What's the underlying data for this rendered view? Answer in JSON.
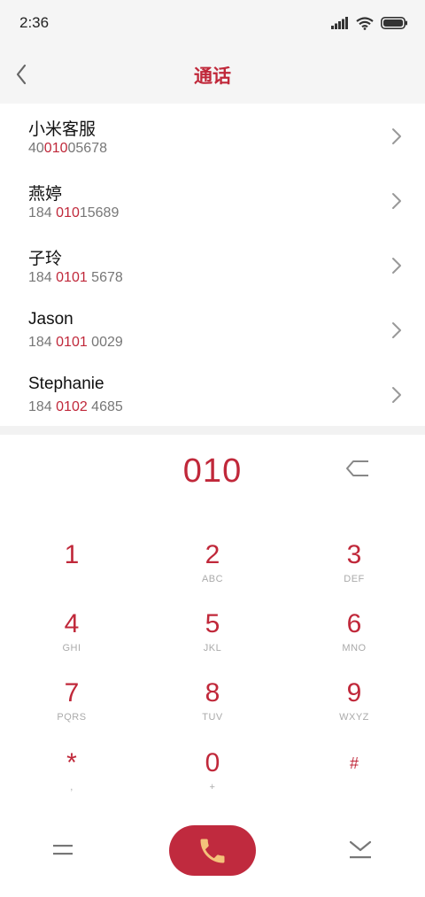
{
  "status_bar": {
    "time": "2:36"
  },
  "header": {
    "title": "通话"
  },
  "contacts": [
    {
      "name": "小米客服",
      "number_pre": "40",
      "number_match": "010",
      "number_post": "05678"
    },
    {
      "name": "燕婷",
      "number_pre": "184 ",
      "number_match": "010",
      "number_post": "15689"
    },
    {
      "name": "子玲",
      "number_pre": "184 ",
      "number_match": "0101",
      "number_post": " 5678"
    },
    {
      "name": "Jason",
      "number_pre": "184 ",
      "number_match": "0101",
      "number_post": " 0029"
    },
    {
      "name": "Stephanie",
      "number_pre": "184 ",
      "number_match": "0102",
      "number_post": " 4685"
    }
  ],
  "dialer": {
    "input": "010"
  },
  "keypad": [
    {
      "digit": "1",
      "letters": ""
    },
    {
      "digit": "2",
      "letters": "ABC"
    },
    {
      "digit": "3",
      "letters": "DEF"
    },
    {
      "digit": "4",
      "letters": "GHI"
    },
    {
      "digit": "5",
      "letters": "JKL"
    },
    {
      "digit": "6",
      "letters": "MNO"
    },
    {
      "digit": "7",
      "letters": "PQRS"
    },
    {
      "digit": "8",
      "letters": "TUV"
    },
    {
      "digit": "9",
      "letters": "WXYZ"
    },
    {
      "digit": "*",
      "letters": ","
    },
    {
      "digit": "0",
      "letters": "+"
    },
    {
      "digit": "#",
      "letters": ""
    }
  ],
  "colors": {
    "accent": "#c0283a",
    "call_button": "#c02a3e",
    "call_icon": "#f4c27a"
  },
  "icons": {
    "back": "chevron-left-icon",
    "row_arrow": "chevron-right-icon",
    "backspace": "backspace-icon",
    "menu": "menu-icon",
    "call": "phone-icon",
    "collapse": "collapse-keypad-icon"
  }
}
